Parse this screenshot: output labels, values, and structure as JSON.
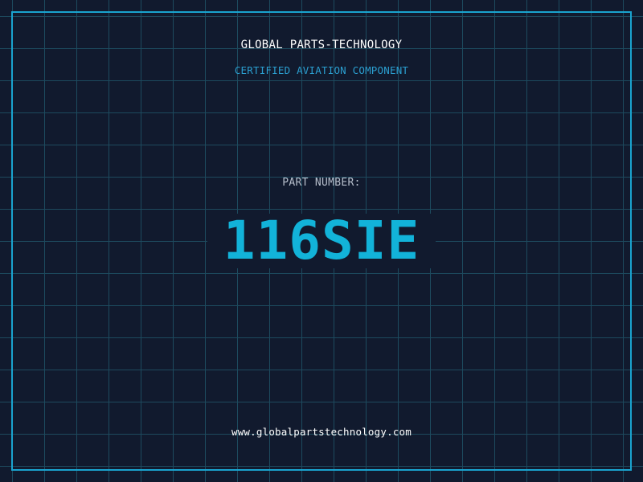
{
  "brand": {
    "name": "GLOBAL PARTS-TECHNOLOGY",
    "tagline": "CERTIFIED AVIATION COMPONENT"
  },
  "part": {
    "label": "PART NUMBER:",
    "number": "116SIE"
  },
  "footer": {
    "website": "www.globalpartstechnology.com"
  },
  "colors": {
    "background": "#111a2e",
    "grid": "#1d4a5e",
    "frame": "#1aa3cf",
    "accent": "#12b3d9",
    "label": "#b7bfcc"
  }
}
